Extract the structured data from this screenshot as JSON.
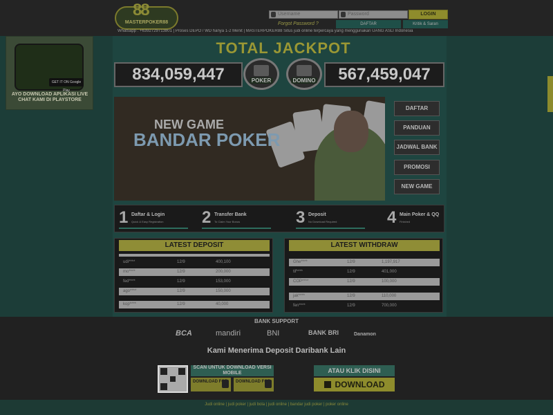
{
  "header": {
    "logo_number": "88",
    "logo_text": "MASTERPOKER88",
    "username_placeholder": "Username",
    "password_placeholder": "Password",
    "login_label": "LOGIN",
    "forgot_label": "Forgot Password ?",
    "daftar_label": "DAFTAR",
    "kritik_label": "Kritik & Saran",
    "ticker": "Whatsapp : +6392729713801 | Proses DEPO / WD hanya 1-2 Menit | MASTERPOKER88 Situs judi online terpercaya yang menggunakan UANG ASLI Indonesia"
  },
  "ad": {
    "store_label": "GET IT ON Google Play",
    "text": "AYO DOWNLOAD APLIKASI LIVE CHAT KAMI DI PLAYSTORE"
  },
  "jackpot": {
    "title": "TOTAL JACKPOT",
    "poker_value": "834,059,447",
    "poker_label": "POKER",
    "domino_value": "567,459,047",
    "domino_label": "DOMINO"
  },
  "banner": {
    "line1": "NEW GAME",
    "line2": "BANDAR POKER"
  },
  "side_menu": [
    "DAFTAR",
    "PANDUAN",
    "JADWAL BANK",
    "PROMOSI",
    "NEW GAME"
  ],
  "steps": [
    {
      "num": "1",
      "title": "Daftar & Login",
      "sub": "Quick & Easy Registration"
    },
    {
      "num": "2",
      "title": "Transfer Bank",
      "sub": "To Claim Your Bonus"
    },
    {
      "num": "3",
      "title": "Deposit",
      "sub": "No Download Required"
    },
    {
      "num": "4",
      "title": "Main Poker & QQ",
      "sub": "Finished"
    }
  ],
  "deposit": {
    "title": "LATEST DEPOSIT",
    "rows": [
      {
        "user": "udi****",
        "date": "12/9",
        "amount": "400,100"
      },
      {
        "user": "mo****",
        "date": "12/9",
        "amount": "200,000"
      },
      {
        "user": "fed****",
        "date": "12/9",
        "amount": "153,000"
      },
      {
        "user": "ago****",
        "date": "12/9",
        "amount": "150,000"
      },
      {
        "user": "kop****",
        "date": "12/9",
        "amount": "40,000"
      }
    ]
  },
  "withdraw": {
    "title": "LATEST WITHDRAW",
    "rows": [
      {
        "user": "Ghe****",
        "date": "12/9",
        "amount": "1,197,917"
      },
      {
        "user": "tif****",
        "date": "12/9",
        "amount": "401,000"
      },
      {
        "user": "COP****",
        "date": "12/9",
        "amount": "100,000"
      },
      {
        "user": "jak****",
        "date": "12/9",
        "amount": "110,000"
      },
      {
        "user": "fen****",
        "date": "12/9",
        "amount": "700,000"
      }
    ]
  },
  "footer": {
    "bank_support": "BANK SUPPORT",
    "banks": [
      "BCA",
      "mandiri",
      "BNI",
      "BANK BRI",
      "Danamon"
    ],
    "accept_text": "Kami Menerima Deposit Daribank Lain",
    "scan_text": "SCAN UNTUK DOWNLOAD VERSI MOBILE",
    "dl_android": "DOWNLOAD FOR",
    "dl_ios": "DOWNLOAD FOR",
    "atau_text": "ATAU KLIK DISINI",
    "download_label": "DOWNLOAD",
    "links": "Judi online  |  judi poker  |  judi bola  |  judi online  |  bandar judi poker  |  poker online"
  }
}
